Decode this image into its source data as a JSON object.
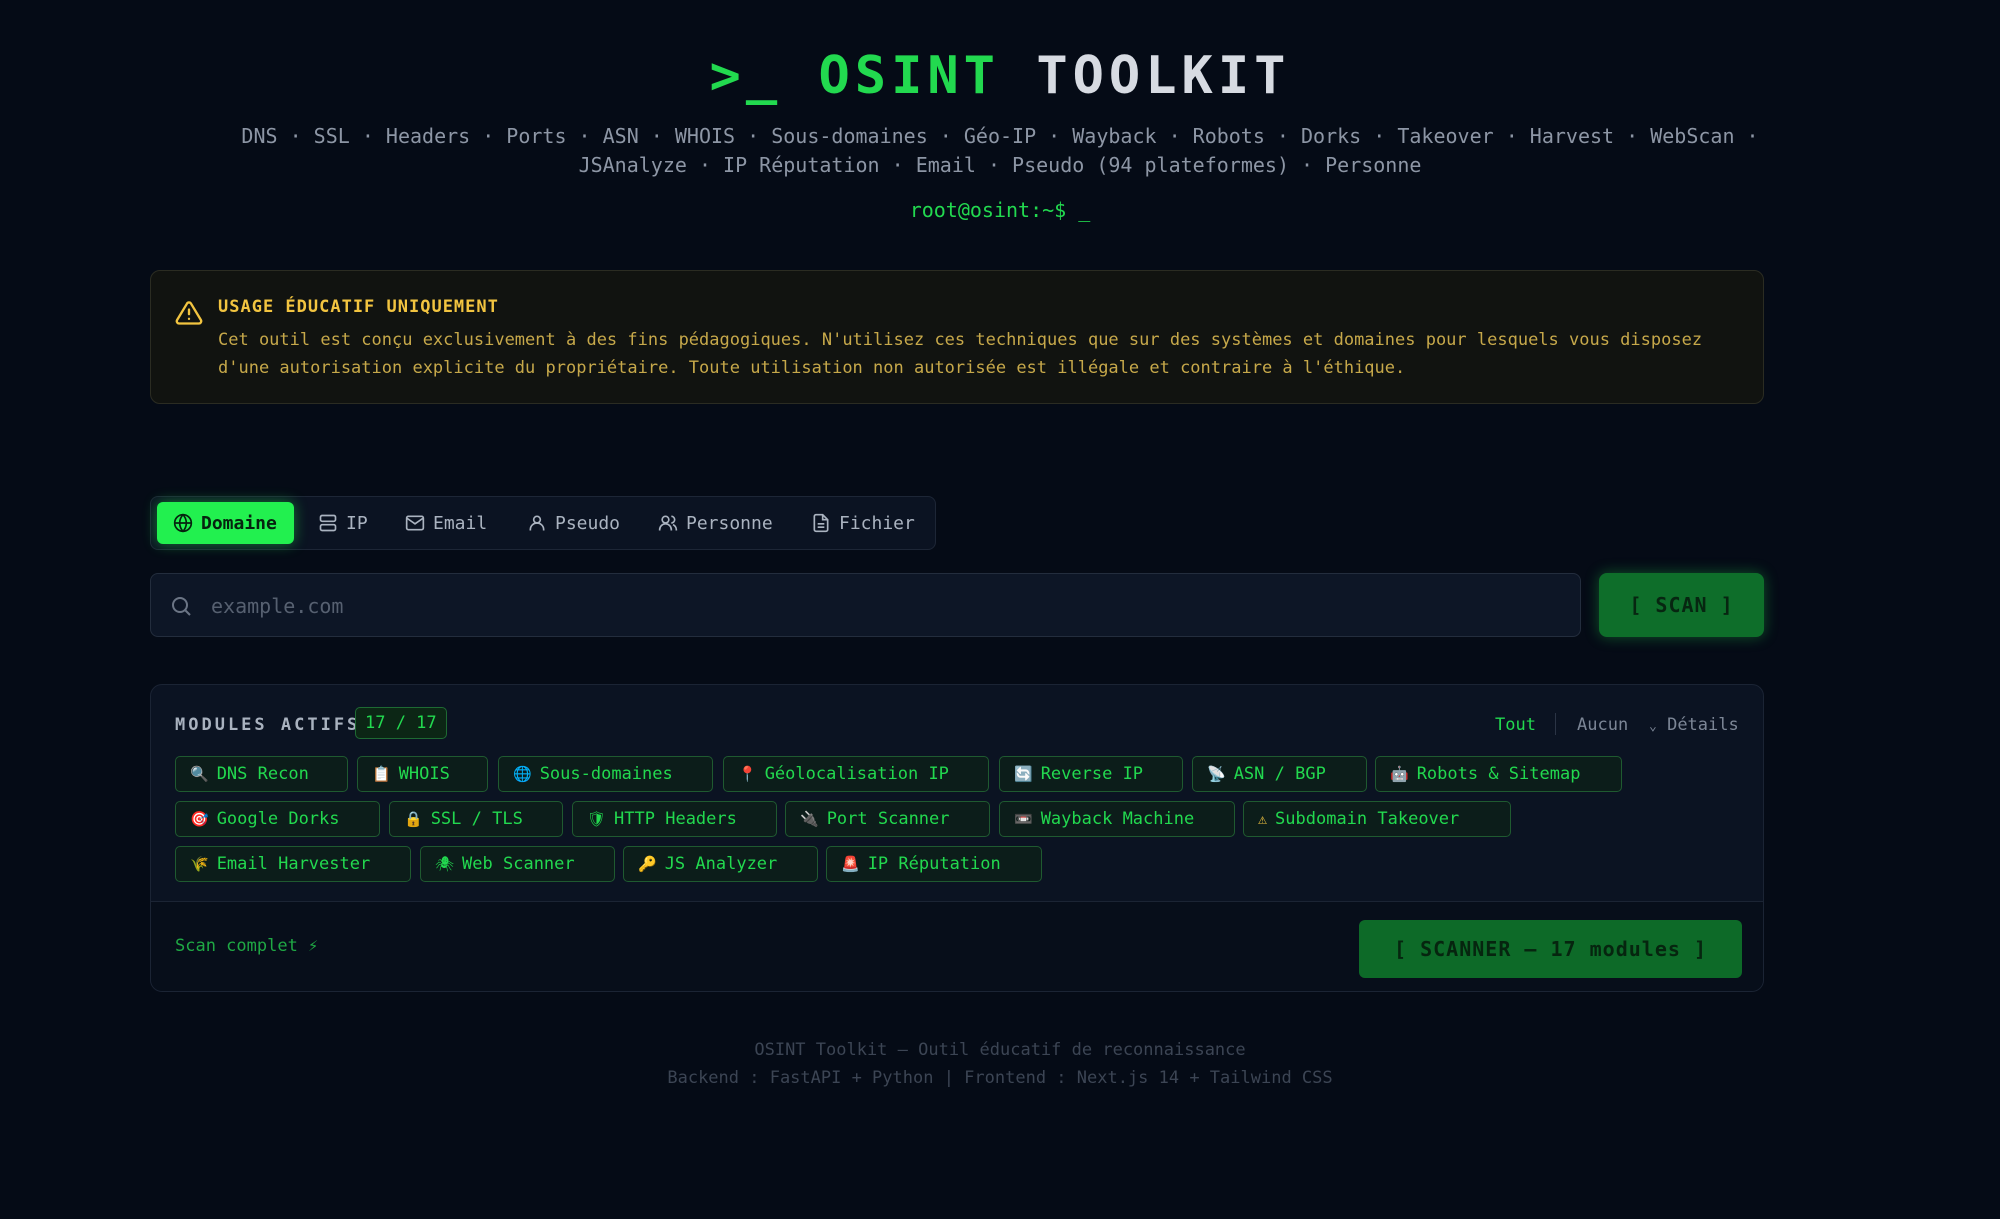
{
  "header": {
    "prompt_symbol": ">_",
    "title_part1": "OSINT",
    "title_part2": "TOOLKIT",
    "features_line1": "DNS · SSL · Headers · Ports · ASN · WHOIS · Sous-domaines · Géo-IP · Wayback · Robots · Dorks · Takeover · Harvest · WebScan ·",
    "features_line2": "JSAnalyze · IP Réputation · Email · Pseudo (94 plateformes) · Personne",
    "shell_prompt": "root@osint:~$ _"
  },
  "warning": {
    "title": "USAGE ÉDUCATIF UNIQUEMENT",
    "line1": "Cet outil est conçu exclusivement à des fins pédagogiques. N'utilisez ces techniques que sur des systèmes et domaines pour lesquels vous disposez",
    "line2": "d'une autorisation explicite du propriétaire. Toute utilisation non autorisée est illégale et contraire à l'éthique.",
    "color": "#f2c440"
  },
  "tabs": [
    {
      "label": "Domaine",
      "icon": "globe-icon",
      "active": true
    },
    {
      "label": "IP",
      "icon": "server-icon",
      "active": false
    },
    {
      "label": "Email",
      "icon": "mail-icon",
      "active": false
    },
    {
      "label": "Pseudo",
      "icon": "user-icon",
      "active": false
    },
    {
      "label": "Personne",
      "icon": "users-icon",
      "active": false
    },
    {
      "label": "Fichier",
      "icon": "file-icon",
      "active": false
    }
  ],
  "search": {
    "placeholder": "example.com",
    "value": "",
    "scan_label": "[ SCAN ]"
  },
  "modules": {
    "title": "MODULES ACTIFS",
    "count": "17 / 17",
    "ctrl_all": "Tout",
    "ctrl_none": "Aucun",
    "ctrl_details": "Détails",
    "items": [
      {
        "icon": "🔍",
        "label": "DNS Recon"
      },
      {
        "icon": "📋",
        "label": "WHOIS"
      },
      {
        "icon": "🌐",
        "label": "Sous-domaines"
      },
      {
        "icon": "📍",
        "label": "Géolocalisation IP"
      },
      {
        "icon": "🔄",
        "label": "Reverse IP"
      },
      {
        "icon": "📡",
        "label": "ASN / BGP"
      },
      {
        "icon": "🤖",
        "label": "Robots & Sitemap"
      },
      {
        "icon": "🎯",
        "label": "Google Dorks"
      },
      {
        "icon": "🔒",
        "label": "SSL / TLS"
      },
      {
        "icon": "🛡",
        "label": "HTTP Headers"
      },
      {
        "icon": "🔌",
        "label": "Port Scanner"
      },
      {
        "icon": "📼",
        "label": "Wayback Machine"
      },
      {
        "icon": "⚠",
        "label": "Subdomain Takeover"
      },
      {
        "icon": "🌾",
        "label": "Email Harvester"
      },
      {
        "icon": "🕷",
        "label": "Web Scanner"
      },
      {
        "icon": "🔑",
        "label": "JS Analyzer"
      },
      {
        "icon": "🚨",
        "label": "IP Réputation"
      }
    ],
    "status": "Scan complet ⚡",
    "scanner_label": "[ SCANNER — 17 modules ]"
  },
  "footer": {
    "line1": "OSINT Toolkit — Outil éducatif de reconnaissance",
    "line2": "Backend : FastAPI + Python | Frontend : Next.js 14 + Tailwind CSS"
  },
  "colors": {
    "accent": "#22d94f",
    "background": "#050b16",
    "warning": "#f2c440"
  }
}
